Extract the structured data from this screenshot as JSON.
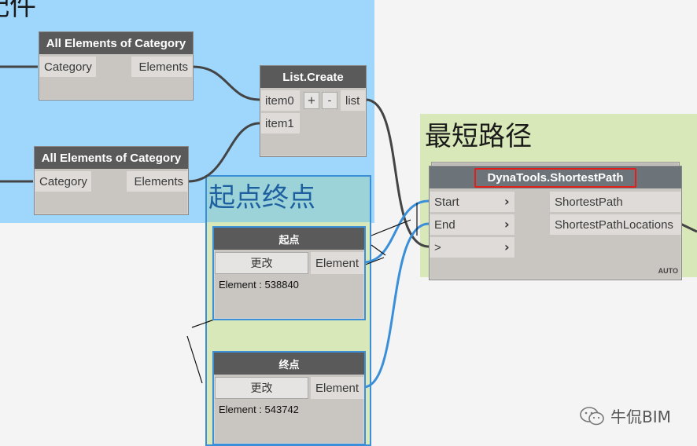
{
  "groups": {
    "blue_title": "配件",
    "start_end_title": "起点终点",
    "shortest_title": "最短路径"
  },
  "nodes": {
    "aeoc1": {
      "title": "All Elements of Category",
      "in_port": "Category",
      "out_port": "Elements"
    },
    "aeoc2": {
      "title": "All Elements of Category",
      "in_port": "Category",
      "out_port": "Elements"
    },
    "list_create": {
      "title": "List.Create",
      "in0": "item0",
      "in1": "item1",
      "add": "+",
      "remove": "-",
      "out": "list"
    },
    "start_node": {
      "title": "起点",
      "button": "更改",
      "out": "Element",
      "value": "Element : 538840"
    },
    "end_node": {
      "title": "终点",
      "button": "更改",
      "out": "Element",
      "value": "Element : 543742"
    },
    "shortest": {
      "title": "DynaTools.ShortestPath",
      "inputs": [
        "Start",
        "End",
        ">"
      ],
      "outputs": [
        "ShortestPath",
        "ShortestPathLocations"
      ],
      "lacing": "AUTO"
    }
  },
  "watermark": {
    "text": "牛侃BIM",
    "icon": "wechat-icon"
  },
  "colors": {
    "blue_group": "#9fd6fb",
    "green_group": "#d9e8b8",
    "wire_blue": "#3b8fd8",
    "wire_dark": "#444444",
    "highlight": "#e0201a"
  }
}
